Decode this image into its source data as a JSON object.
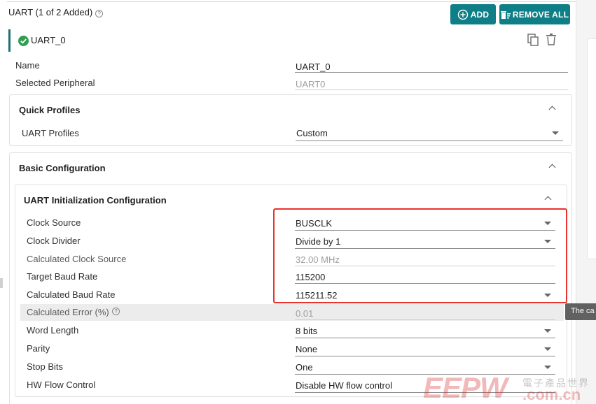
{
  "header": {
    "title": "UART (1 of 2 Added)",
    "help_icon": "?",
    "add_label": "ADD",
    "remove_all_label": "REMOVE ALL"
  },
  "instance": {
    "name": "UART_0",
    "status_icon": "check-circle-icon",
    "actions": [
      "copy-icon",
      "trash-icon"
    ]
  },
  "fields": {
    "name": {
      "label": "Name",
      "value": "UART_0"
    },
    "selected_peripheral": {
      "label": "Selected Peripheral",
      "value": "UART0"
    }
  },
  "quick_profiles": {
    "title": "Quick Profiles",
    "uart_profiles": {
      "label": "UART Profiles",
      "value": "Custom"
    }
  },
  "basic_config": {
    "title": "Basic Configuration"
  },
  "init_config": {
    "title": "UART Initialization Configuration",
    "rows": [
      {
        "label": "Clock Source",
        "value": "BUSCLK",
        "type": "select"
      },
      {
        "label": "Clock Divider",
        "value": "Divide by 1",
        "type": "select"
      },
      {
        "label": "Calculated Clock Source",
        "value": "32.00 MHz",
        "type": "readonly"
      },
      {
        "label": "Target Baud Rate",
        "value": "115200",
        "type": "input"
      },
      {
        "label": "Calculated Baud Rate",
        "value": "115211.52",
        "type": "select"
      },
      {
        "label": "Calculated Error (%)",
        "value": "0.01",
        "type": "readonly"
      },
      {
        "label": "Word Length",
        "value": "8 bits",
        "type": "select"
      },
      {
        "label": "Parity",
        "value": "None",
        "type": "select"
      },
      {
        "label": "Stop Bits",
        "value": "One",
        "type": "select"
      },
      {
        "label": "HW Flow Control",
        "value": "Disable HW flow control",
        "type": "select"
      }
    ]
  },
  "tooltip": {
    "text": "The ca"
  },
  "watermark": {
    "logo": "EEPW",
    "cn": "電子產品世界",
    "domain": ".com.cn"
  },
  "colors": {
    "accent": "#0e7f86",
    "highlight_box": "#e8332e",
    "success": "#2e9e4f"
  }
}
